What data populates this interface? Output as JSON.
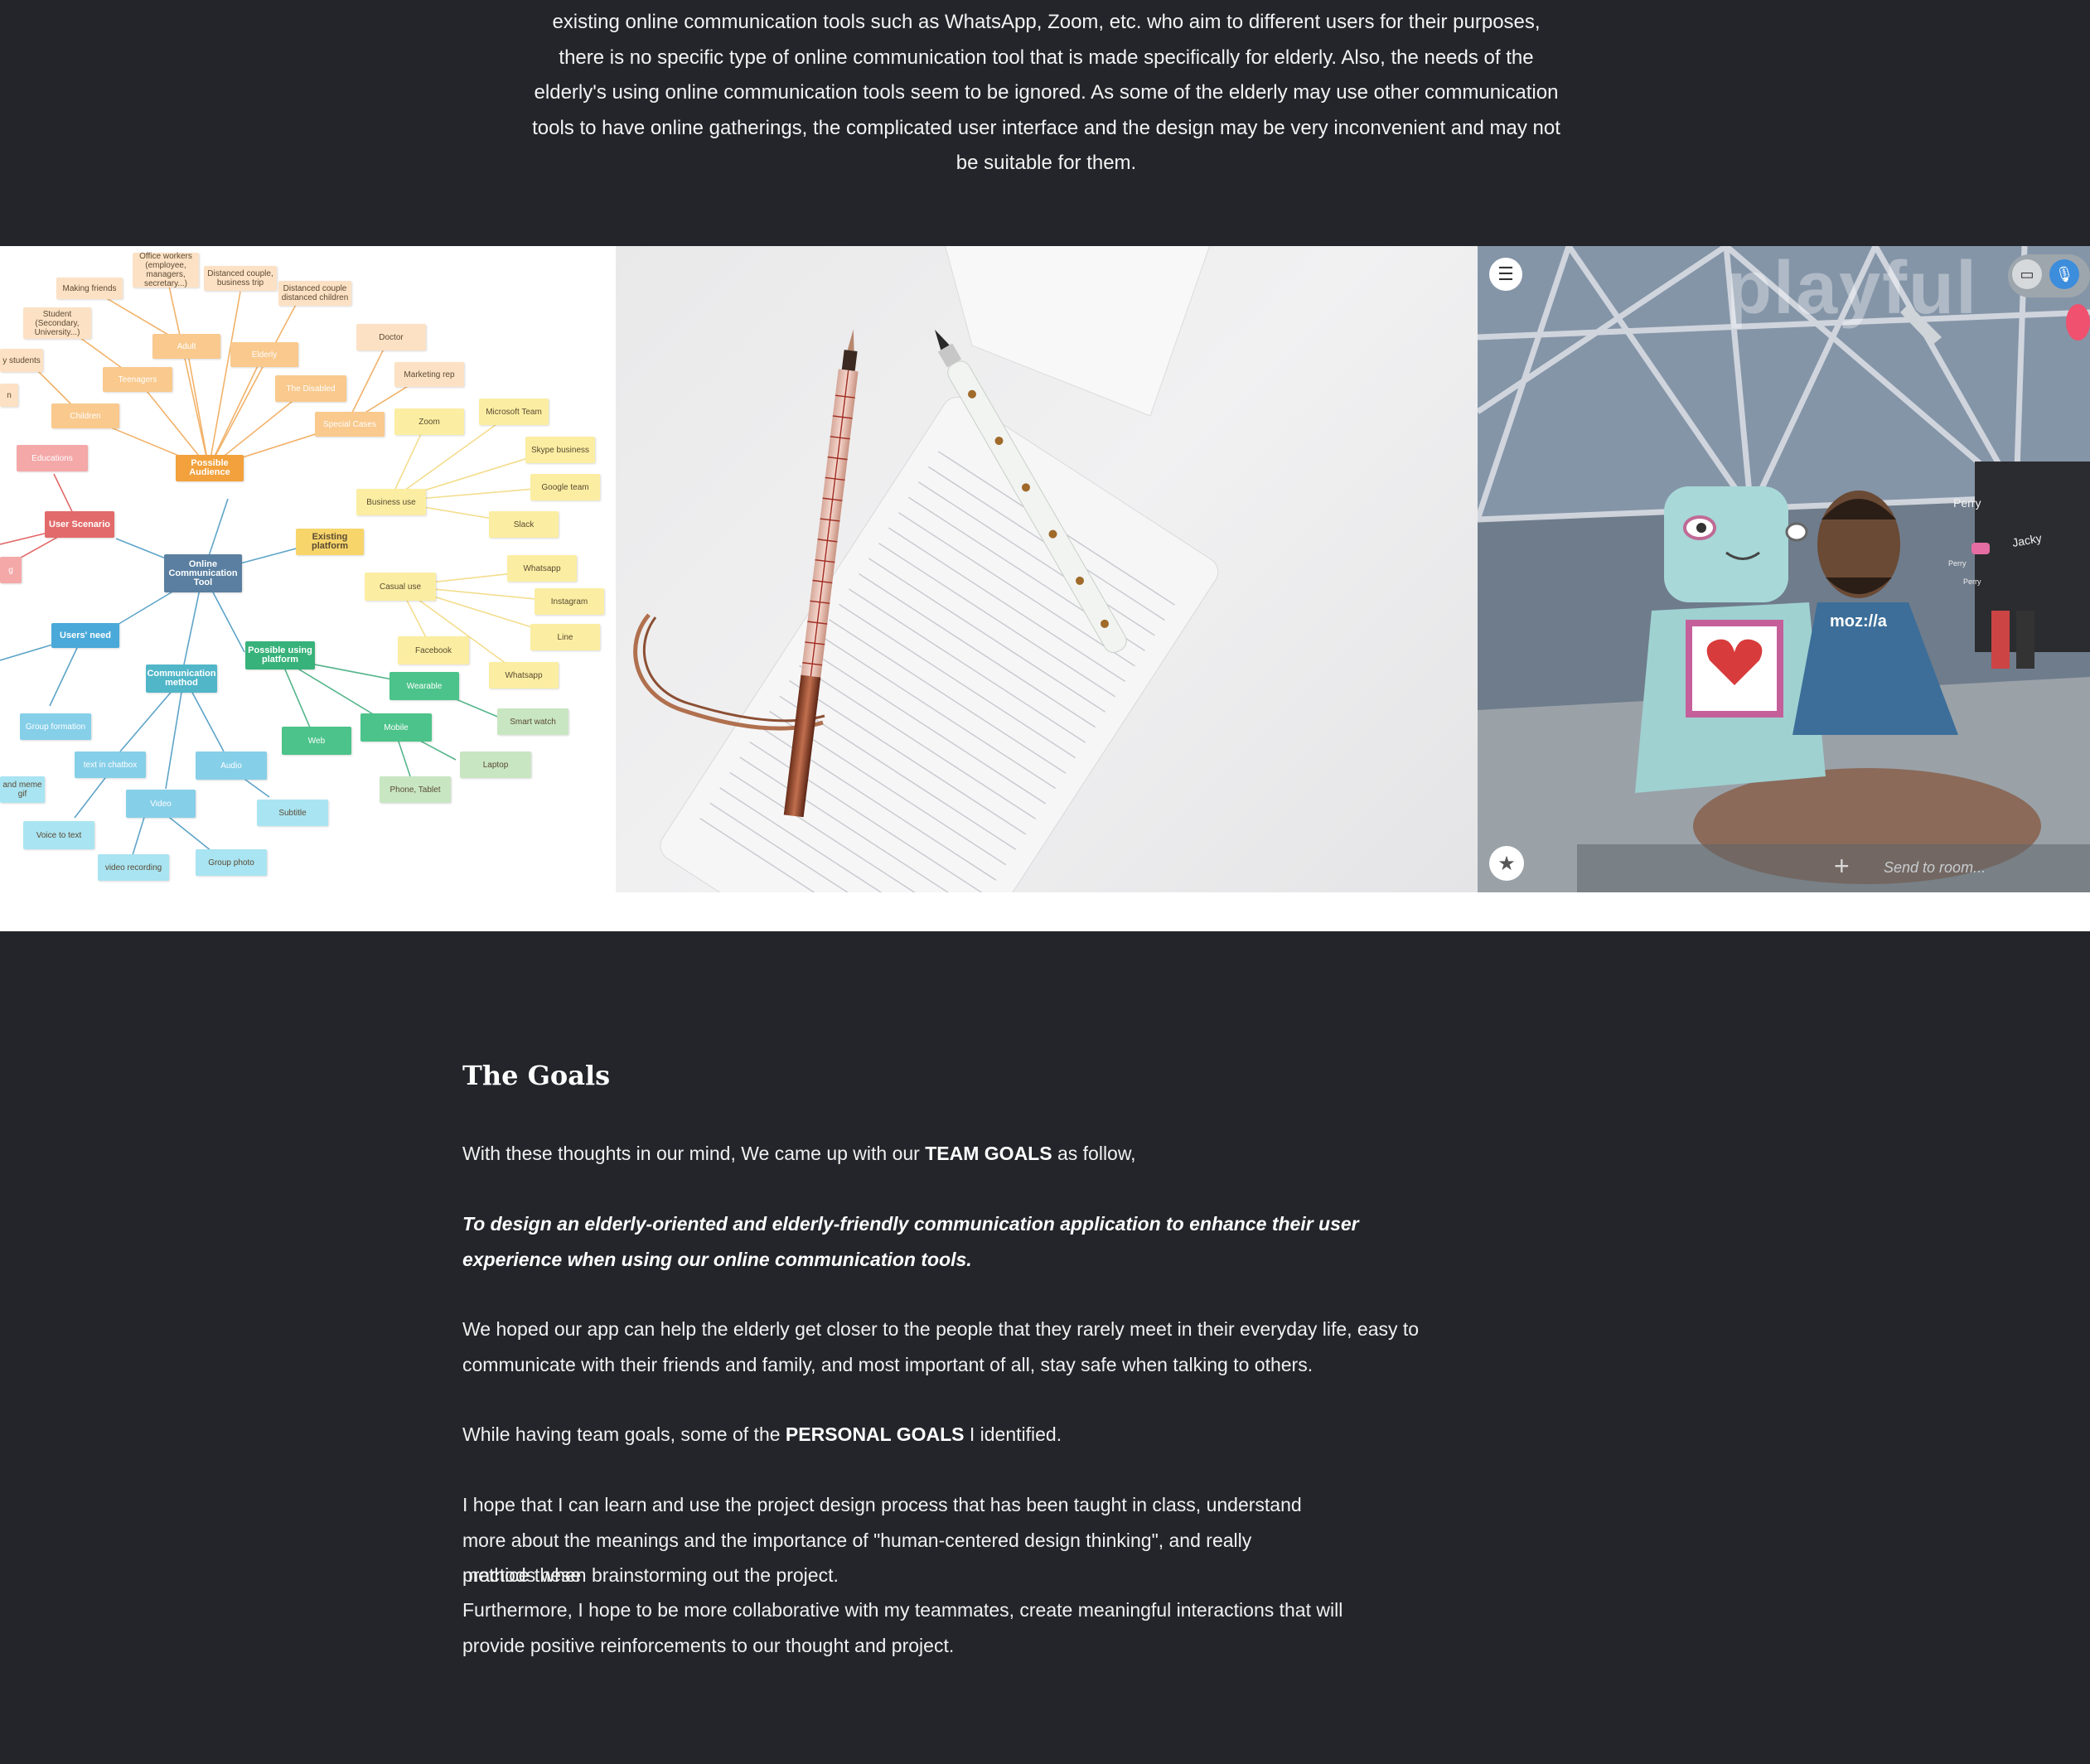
{
  "intro": {
    "text": "existing online communication tools such as WhatsApp, Zoom, etc. who aim to different users for their purposes, there is no specific type of online communication tool that is made specifically for elderly. Also, the needs of the elderly's using online communication tools seem to be ignored. As some of the elderly may use other communication tools to have online gatherings, the complicated user interface and the design may be very inconvenient and may not be suitable for them."
  },
  "mindmap": {
    "center": "Online Communication Tool",
    "nodes": {
      "possible_audience": "Possible Audience",
      "existing_platform": "Existing platform",
      "user_scenario": "User Scenario",
      "users_need": "Users' need",
      "communication_method": "Communication method",
      "possible_using_platform": "Possible using platform",
      "office_workers": "Office workers (employee, managers, secretary...)",
      "distanced_couple_trip": "Distanced couple, business trip",
      "distanced_couple_children": "Distanced couple distanced children",
      "making_friends": "Making friends",
      "student": "Student (Secondary, University...)",
      "y_students": "y students",
      "n": "n",
      "adult": "Adult",
      "elderly": "Elderly",
      "doctor": "Doctor",
      "teenagers": "Teenagers",
      "marketing_rep": "Marketing rep",
      "the_disabled": "The Disabled",
      "children": "Children",
      "special_cases": "Special Cases",
      "zoom": "Zoom",
      "microsoft_team": "Microsoft Team",
      "skype_business": "Skype business",
      "google_team": "Google team",
      "business_use": "Business use",
      "slack": "Slack",
      "educations": "Educations",
      "g": "g",
      "casual_use": "Casual use",
      "whatsapp1": "Whatsapp",
      "instagram": "Instagram",
      "line": "Line",
      "facebook": "Facebook",
      "whatsapp2": "Whatsapp",
      "wearable": "Wearable",
      "smart_watch": "Smart watch",
      "mobile": "Mobile",
      "web": "Web",
      "laptop": "Laptop",
      "phone_tablet": "Phone, Tablet",
      "group_formation": "Group formation",
      "text_in_chatbox": "text in chatbox",
      "audio": "Audio",
      "and_meme": "and meme gif",
      "video": "Video",
      "subtitle": "Subtitle",
      "voice_to_text": "Voice to text",
      "video_recording": "video recording",
      "group_photo": "Group photo"
    }
  },
  "vr": {
    "wall_text": "playful",
    "name_tags": [
      "Perry",
      "Jacky",
      "Perry",
      "Perry"
    ],
    "shirt_text": "moz://a",
    "chat_placeholder": "Send to room..."
  },
  "goals": {
    "heading": "The Goals",
    "p1_before": "With these thoughts in our mind, We came up with our ",
    "p1_strong": "TEAM GOALS",
    "p1_after": " as follow,",
    "p2_italic": "To design an elderly-oriented and elderly-friendly communication application to enhance their user experience when using our online communication tools.",
    "p3": "We hoped our app can help the elderly get closer to the people that they rarely meet in their everyday life, easy to communicate with their friends and family, and most important of all, stay safe when talking to others.",
    "p4_before": "While having team goals, some of the ",
    "p4_strong": "PERSONAL GOALS",
    "p4_after": " I identified.",
    "p5_line1": "I hope that I can learn and use the project design process that has been taught in class, understand more about the meanings and the importance of \"human-centered design thinking\", and really practice these",
    "p5_line2": "methods when brainstorming out the project.",
    "p5_line3": "Furthermore, I hope to be more collaborative with my teammates, create meaningful interactions that will provide positive reinforcements to our thought and project."
  },
  "colors": {
    "background": "#23252a",
    "hub_blue": "#5a7fa0",
    "audience": "#f2a13c",
    "existing": "#f7d56b",
    "scenario": "#e36a6a",
    "needs": "#4aa9d8",
    "comm": "#50b6c8",
    "platform": "#37b27a"
  }
}
